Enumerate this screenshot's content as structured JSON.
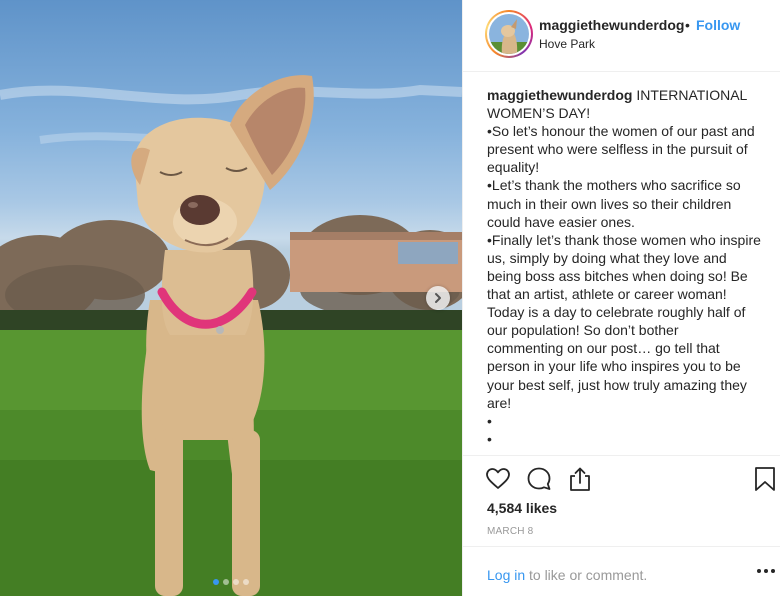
{
  "post": {
    "username": "maggiethewunderdog",
    "separator": "•",
    "follow_label": "Follow",
    "location": "Hove Park",
    "caption": {
      "username": "maggiethewunderdog",
      "lines": [
        "INTERNATIONAL",
        "WOMEN’S DAY!",
        "•So let’s honour the women of our past and",
        "present who were selfless in the pursuit of",
        "equality!",
        "•Let’s thank the mothers who sacrifice so",
        "much in their own lives so their children",
        "could have easier ones.",
        "•Finally let’s thank those women who inspire",
        "us, simply by doing what they love and",
        "being boss ass bitches when doing so! Be",
        "that an artist, athlete or career woman!",
        "Today is a day to celebrate roughly half of",
        "our population! So don’t bother",
        "commenting on our post… go tell that",
        "person in your life who inspires you to be",
        "your best self, just how truly amazing they",
        "are!",
        "•",
        "•"
      ]
    },
    "likes": "4,584 likes",
    "date": "MARCH 8",
    "login_link": "Log in",
    "login_rest": "to like or comment.",
    "carousel": {
      "total": 4,
      "active": 1
    }
  },
  "icons": {
    "like": "heart-icon",
    "comment": "comment-icon",
    "share": "share-icon",
    "save": "bookmark-icon",
    "next": "chevron-right-icon",
    "more": "more-options-icon"
  },
  "colors": {
    "link": "#3897f0",
    "text": "#262626",
    "muted": "#999999",
    "border": "#efefef"
  }
}
